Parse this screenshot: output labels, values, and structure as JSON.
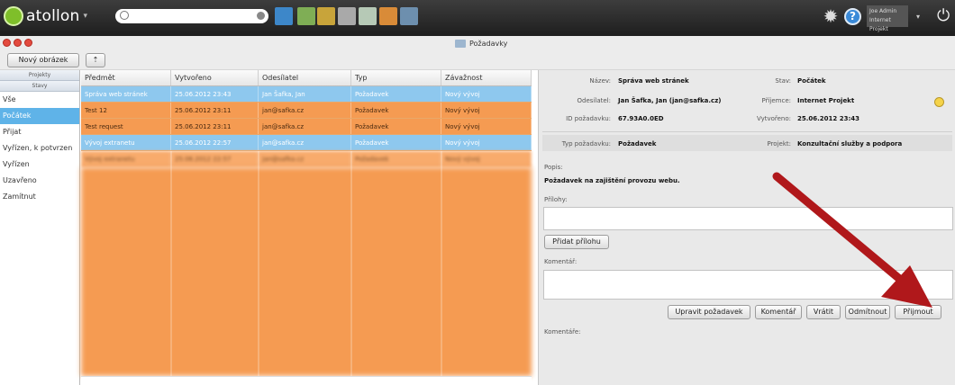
{
  "app": {
    "name": "atollon",
    "window_title": "Požadavky"
  },
  "topbar": {
    "search_placeholder": "",
    "user_line1": "Joe Admin",
    "user_line2": "Internet Projekt",
    "help_label": "?"
  },
  "toolbar": {
    "new_order_label": "Nový obrázek",
    "secondary_label": "⇡"
  },
  "sidebar": {
    "section_projects": "Projekty",
    "section_state": "Stavy",
    "items": [
      {
        "label": "Vše"
      },
      {
        "label": "Počátek"
      },
      {
        "label": "Přijat"
      },
      {
        "label": "Vyřízen, k potvrzen"
      },
      {
        "label": "Vyřízen"
      },
      {
        "label": "Uzavřeno"
      },
      {
        "label": "Zamítnut"
      }
    ]
  },
  "table": {
    "headers": [
      "Předmět",
      "Vytvořeno",
      "Odesílatel",
      "Typ",
      "Závažnost"
    ],
    "rows": [
      {
        "subject": "Správa web stránek",
        "created": "25.06.2012 23:43",
        "sender": "Jan Šafka, Jan",
        "type": "Požadavek",
        "severity": "Nový vývoj"
      },
      {
        "subject": "Test 12",
        "created": "25.06.2012 23:11",
        "sender": "jan@safka.cz",
        "type": "Požadavek",
        "severity": "Nový vývoj"
      },
      {
        "subject": "Test request",
        "created": "25.06.2012 23:11",
        "sender": "jan@safka.cz",
        "type": "Požadavek",
        "severity": "Nový vývoj"
      },
      {
        "subject": "Vývoj extranetu",
        "created": "25.06.2012 22:57",
        "sender": "jan@safka.cz",
        "type": "Požadavek",
        "severity": "Nový vývoj"
      },
      {
        "subject": "Vývoj extranetu",
        "created": "25.06.2012 22:57",
        "sender": "jan@safka.cz",
        "type": "Požadavek",
        "severity": "Nový vývoj"
      }
    ]
  },
  "detail": {
    "name_label": "Název:",
    "name_value": "Správa web stránek",
    "state_label": "Stav:",
    "state_value": "Počátek",
    "sender_label": "Odesílatel:",
    "sender_value": "Jan Šafka, Jan (jan@safka.cz)",
    "recipient_label": "Příjemce:",
    "recipient_value": "Internet Projekt",
    "id_label": "ID požadavku:",
    "id_value": "67.93A0.0ED",
    "created_label": "Vytvořeno:",
    "created_value": "25.06.2012 23:43",
    "type_label": "Typ požadavku:",
    "type_value": "Požadavek",
    "project_label": "Projekt:",
    "project_value": "Konzultační služby a podpora",
    "desc_label": "Popis:",
    "desc_value": "Požadavek na zajištění provozu webu.",
    "attachments_label": "Přílohy:",
    "add_attachment_label": "Přidat přílohu",
    "comment_label": "Komentář:",
    "comments_label": "Komentáře:",
    "buttons": {
      "edit": "Upravit požadavek",
      "comment": "Komentář",
      "return": "Vrátit",
      "reject": "Odmítnout",
      "accept": "Přijmout"
    }
  },
  "colors": {
    "selected_row": "#8ec8ee",
    "orange_row": "#f59b52",
    "accent_arrow": "#b0181b"
  }
}
